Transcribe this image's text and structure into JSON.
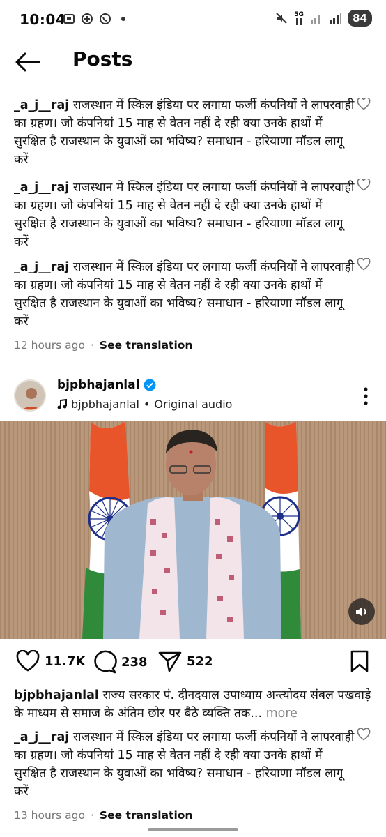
{
  "status_bar": {
    "time": "10:04",
    "network": "5G",
    "battery": "84"
  },
  "header": {
    "title": "Posts"
  },
  "comments_top": [
    {
      "user": "_a_j__raj",
      "text": "राजस्थान में स्किल इंडिया पर लगाया फर्जी कंपनियों ने लापरवाही का ग्रहण। जो कंपनियां 15 माह से वेतन नहीं दे रही क्या उनके हाथों में सुरक्षित है राजस्थान के युवाओं का भविष्य? समाधान - हरियाणा मॉडल लागू करें"
    },
    {
      "user": "_a_j__raj",
      "text": "राजस्थान में स्किल इंडिया पर लगाया फर्जी कंपनियों ने लापरवाही का ग्रहण। जो कंपनियां 15 माह से वेतन नहीं दे रही क्या उनके हाथों में सुरक्षित है राजस्थान के युवाओं का भविष्य? समाधान - हरियाणा मॉडल लागू करें"
    },
    {
      "user": "_a_j__raj",
      "text": "राजस्थान में स्किल इंडिया पर लगाया फर्जी कंपनियों ने लापरवाही का ग्रहण। जो कंपनियां 15 माह से वेतन नहीं दे रही क्या उनके हाथों में सुरक्षित है राजस्थान के युवाओं का भविष्य? समाधान - हरियाणा मॉडल लागू करें"
    }
  ],
  "meta_top": {
    "time": "12 hours ago",
    "separator": "·",
    "see_translation": "See translation"
  },
  "post": {
    "username": "bjpbhajanlal",
    "audio_user": "bjpbhajanlal",
    "audio_sep": "•",
    "audio_label": "Original audio",
    "likes": "11.7K",
    "comments": "238",
    "shares": "522",
    "caption_user": "bjpbhajanlal",
    "caption_text": "राज्य सरकार पं. दीनदयाल उपाध्याय अन्त्योदय संबल पखवाड़े के माध्यम से समाज के अंतिम छोर पर बैठे व्यक्ति तक...",
    "caption_more": "more"
  },
  "comment_bottom": {
    "user": "_a_j__raj",
    "text": "राजस्थान में स्किल इंडिया पर लगाया फर्जी कंपनियों ने लापरवाही का ग्रहण। जो कंपनियां 15 माह से वेतन नहीं दे रही क्या उनके हाथों में सुरक्षित है राजस्थान के युवाओं का भविष्य? समाधान - हरियाणा मॉडल लागू करें"
  },
  "meta_bottom": {
    "time": "13 hours ago",
    "separator": "·",
    "see_translation": "See translation"
  },
  "colors": {
    "verified": "#0095f6",
    "saffron": "#e8552a",
    "india_green": "#2f8a3a",
    "chakra": "#1d2f8a"
  }
}
